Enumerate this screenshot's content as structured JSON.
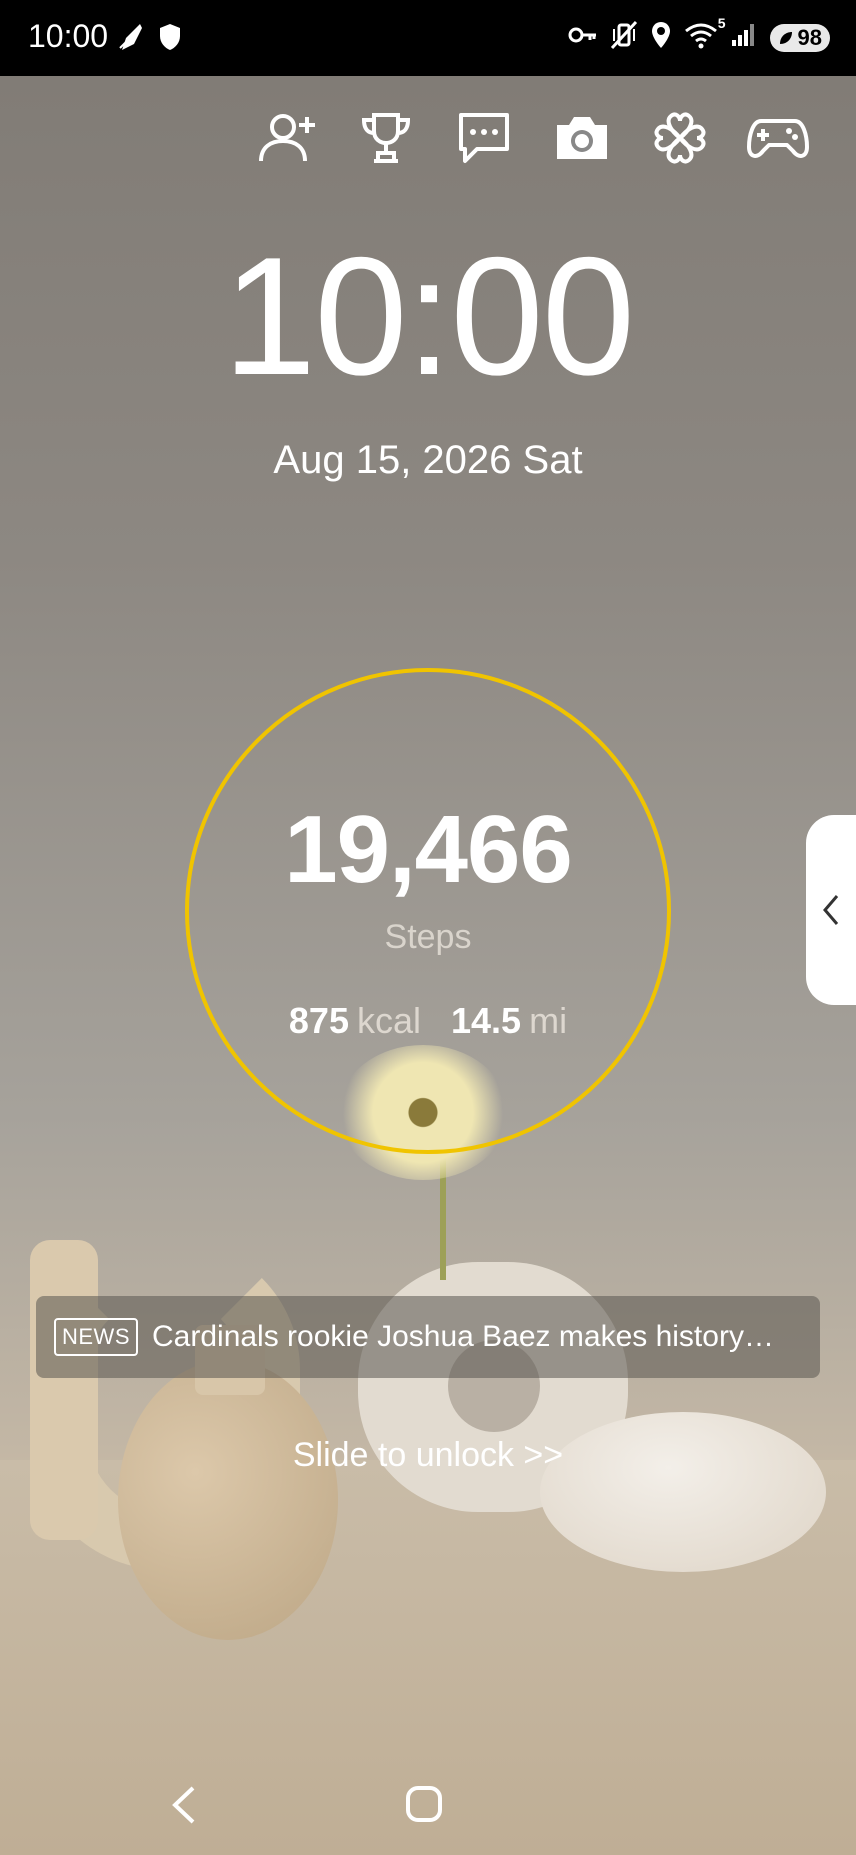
{
  "status_bar": {
    "time": "10:00",
    "battery_level": "98",
    "signal_label": "5",
    "left_icons": [
      "rocket-icon",
      "shield-icon"
    ],
    "right_icons": [
      "key-icon",
      "vibrate-mute-icon",
      "location-icon",
      "wifi-icon",
      "signal-icon",
      "battery-icon"
    ]
  },
  "shortcuts": [
    "add-person-icon",
    "trophy-icon",
    "chat-icon",
    "camera-icon",
    "clover-icon",
    "gamepad-icon"
  ],
  "clock": {
    "time": "10:00",
    "date": "Aug 15, 2026 Sat"
  },
  "steps": {
    "value": "19,466",
    "label": "Steps",
    "calories_value": "875",
    "calories_unit": "kcal",
    "distance_value": "14.5",
    "distance_unit": "mi",
    "ring_color": "#f0c400"
  },
  "news": {
    "badge": "NEWS",
    "headline": "Cardinals rookie Joshua Baez makes history…"
  },
  "unlock": {
    "label": "Slide to unlock >>"
  },
  "nav": {
    "icons": [
      "back-icon",
      "home-icon"
    ]
  }
}
